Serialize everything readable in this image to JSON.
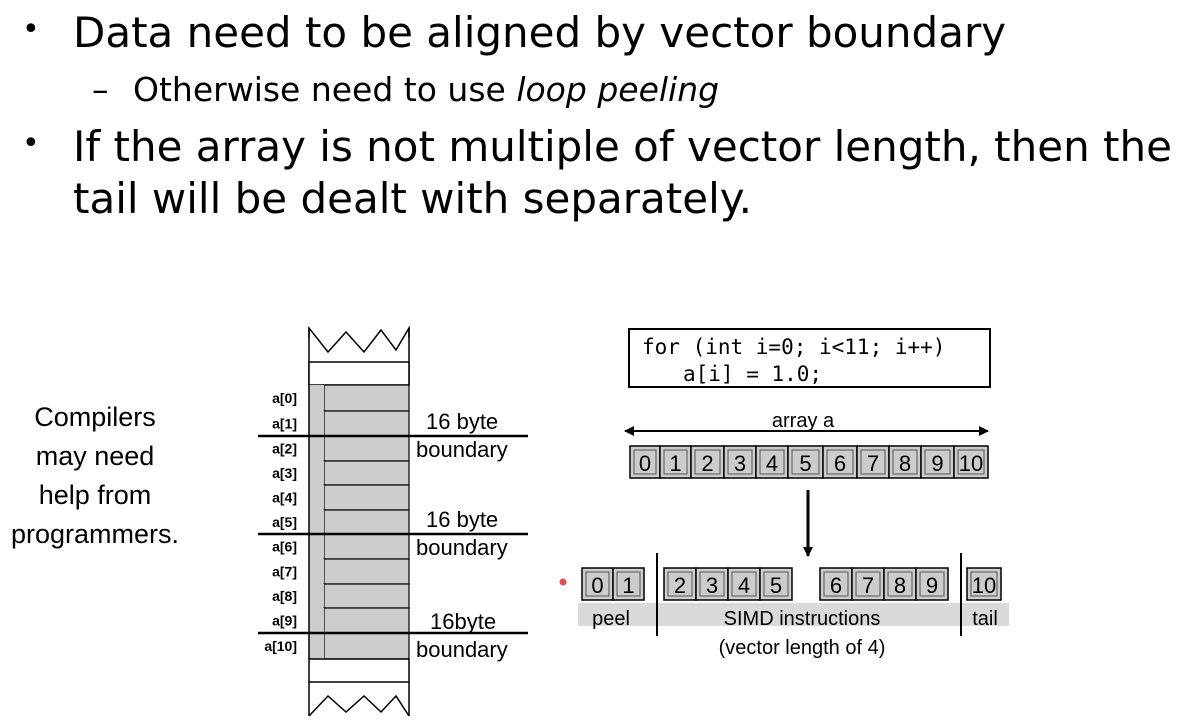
{
  "slide": {
    "bullets": [
      {
        "text": "Data need to be aligned by vector boundary"
      },
      {
        "text": "If the array is not multiple of vector length, then the",
        "text2": "tail will be dealt with separately."
      }
    ],
    "sub_bullet": {
      "dash": "–",
      "prefix": "Otherwise need to use ",
      "emph": "loop peeling"
    },
    "note_lines": [
      "Compilers",
      "may need",
      "help from",
      "programmers."
    ],
    "note_color": "#d93a2b"
  },
  "memory": {
    "labels": [
      "a[0]",
      "a[1]",
      "a[2]",
      "a[3]",
      "a[4]",
      "a[5]",
      "a[6]",
      "a[7]",
      "a[8]",
      "a[9]",
      "a[10]"
    ],
    "boundaries": [
      {
        "l1": "16 byte",
        "l2": "boundary"
      },
      {
        "l1": "16 byte",
        "l2": "boundary"
      },
      {
        "l1": "16byte",
        "l2": "boundary"
      }
    ]
  },
  "code": {
    "line1": "for (int i=0; i<11; i++)",
    "line2": "a[i] = 1.0;"
  },
  "array": {
    "label": "array a",
    "cells": [
      "0",
      "1",
      "2",
      "3",
      "4",
      "5",
      "6",
      "7",
      "8",
      "9",
      "10"
    ]
  },
  "split": {
    "peel_cells": [
      "0",
      "1"
    ],
    "simd_group1": [
      "2",
      "3",
      "4",
      "5"
    ],
    "simd_group2": [
      "6",
      "7",
      "8",
      "9"
    ],
    "tail_cells": [
      "10"
    ],
    "peel_label": "peel",
    "simd_label": "SIMD instructions",
    "simd_sub": "(vector length of 4)",
    "tail_label": "tail"
  },
  "colors": {
    "cell_fill": "#cccccc",
    "laser_dot": "#e05050"
  }
}
